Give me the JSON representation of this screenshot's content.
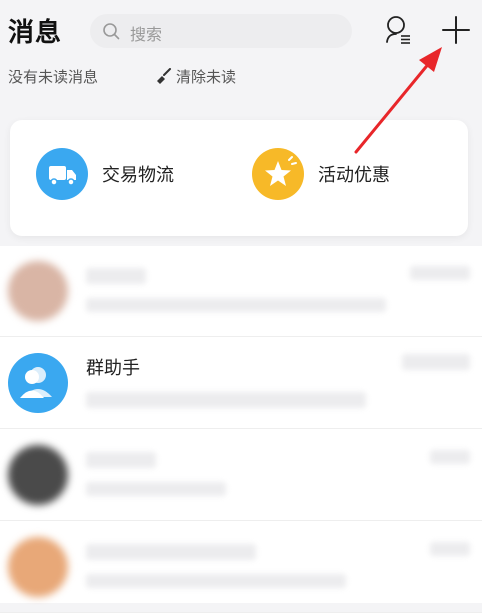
{
  "header": {
    "title": "消息",
    "search_placeholder": "搜索"
  },
  "subheader": {
    "unread_text": "没有未读消息",
    "clear_label": "清除未读"
  },
  "categories": [
    {
      "label": "交易物流",
      "icon": "truck-icon",
      "color": "#3aa8f0"
    },
    {
      "label": "活动优惠",
      "icon": "star-icon",
      "color": "#f7b928"
    }
  ],
  "conversations": [
    {
      "name": ""
    },
    {
      "name": "群助手"
    },
    {
      "name": ""
    },
    {
      "name": ""
    }
  ],
  "colors": {
    "accent": "#ff5a1f",
    "annotation_arrow": "#e8262a"
  }
}
